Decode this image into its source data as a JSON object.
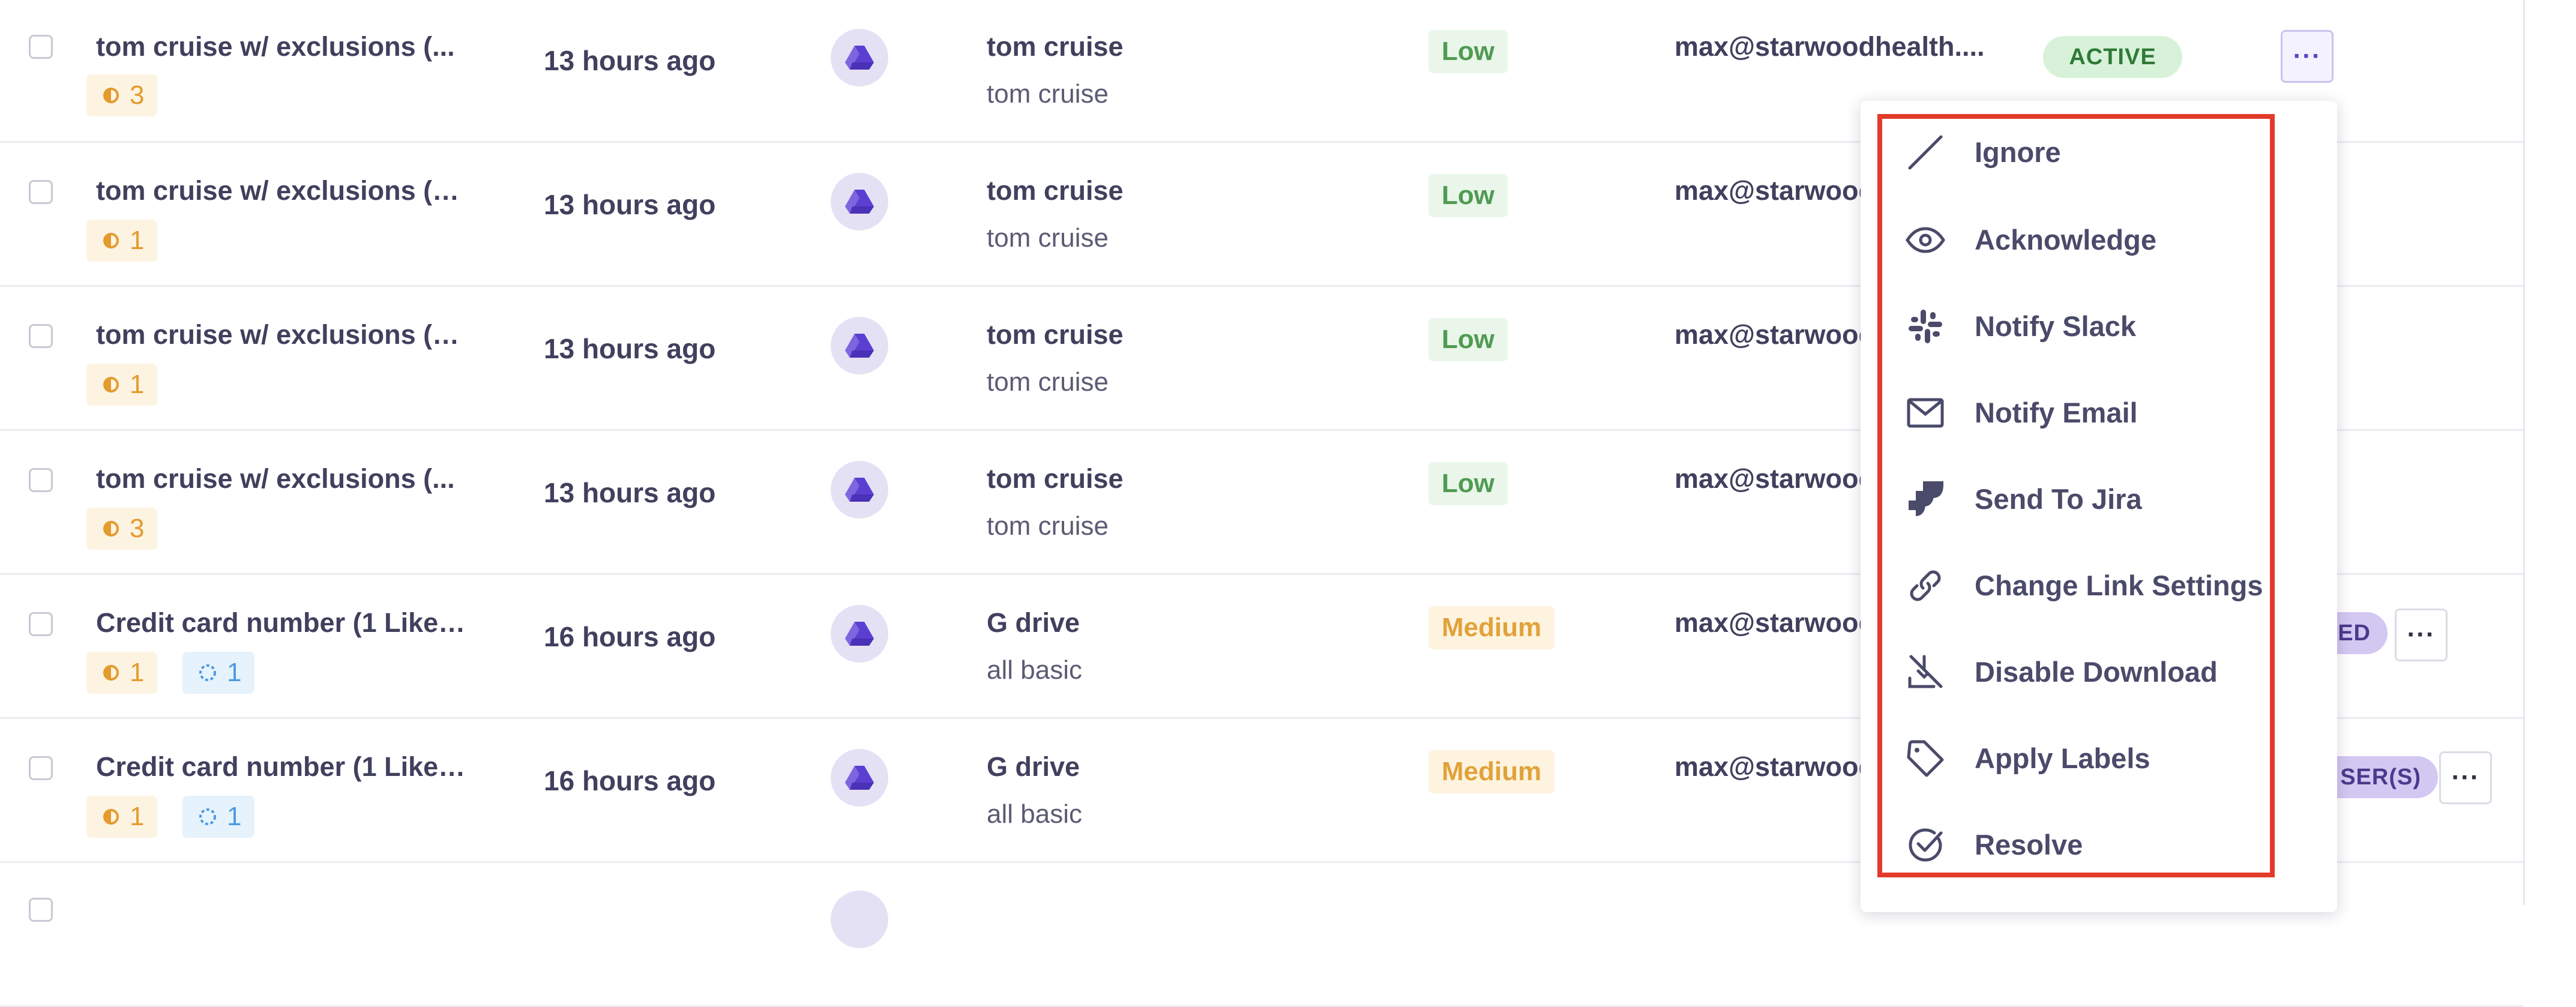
{
  "rows": [
    {
      "title": "tom cruise w/ exclusions (...",
      "chips": [
        {
          "kind": "orange",
          "icon": "half-circle-icon",
          "count": "3"
        }
      ],
      "time": "13 hours ago",
      "source_icon": "google-drive-icon",
      "owner": "tom cruise",
      "subowner": "tom cruise",
      "severity": "Low",
      "email": "max@starwoodhealth....",
      "status": "ACTIVE"
    },
    {
      "title": "tom cruise w/ exclusions (1...",
      "chips": [
        {
          "kind": "orange",
          "icon": "half-circle-icon",
          "count": "1"
        }
      ],
      "time": "13 hours ago",
      "source_icon": "google-drive-icon",
      "owner": "tom cruise",
      "subowner": "tom cruise",
      "severity": "Low",
      "email": "max@starwood"
    },
    {
      "title": "tom cruise w/ exclusions (1...",
      "chips": [
        {
          "kind": "orange",
          "icon": "half-circle-icon",
          "count": "1"
        }
      ],
      "time": "13 hours ago",
      "source_icon": "google-drive-icon",
      "owner": "tom cruise",
      "subowner": "tom cruise",
      "severity": "Low",
      "email": "max@starwood"
    },
    {
      "title": "tom cruise w/ exclusions (...",
      "chips": [
        {
          "kind": "orange",
          "icon": "half-circle-icon",
          "count": "3"
        }
      ],
      "time": "13 hours ago",
      "source_icon": "google-drive-icon",
      "owner": "tom cruise",
      "subowner": "tom cruise",
      "severity": "Low",
      "email": "max@starwood"
    },
    {
      "title": "Credit card number (1 Likel...",
      "chips": [
        {
          "kind": "orange",
          "icon": "half-circle-icon",
          "count": "1"
        },
        {
          "kind": "blue",
          "icon": "dashed-circle-icon",
          "count": "1"
        }
      ],
      "time": "16 hours ago",
      "source_icon": "google-drive-icon",
      "owner": "G drive",
      "subowner": "all basic",
      "severity": "Medium",
      "email": "max@starwood",
      "status": "ED"
    },
    {
      "title": "Credit card number (1 Likel...",
      "chips": [
        {
          "kind": "orange",
          "icon": "half-circle-icon",
          "count": "1"
        },
        {
          "kind": "blue",
          "icon": "dashed-circle-icon",
          "count": "1"
        }
      ],
      "time": "16 hours ago",
      "source_icon": "google-drive-icon",
      "owner": "G drive",
      "subowner": "all basic",
      "severity": "Medium",
      "email": "max@starwood",
      "status": "SER(S)"
    }
  ],
  "more_button_label": "···",
  "menu": {
    "items": [
      {
        "label": "Ignore",
        "icon": "slash-icon"
      },
      {
        "label": "Acknowledge",
        "icon": "eye-icon"
      },
      {
        "label": "Notify Slack",
        "icon": "slack-icon"
      },
      {
        "label": "Notify Email",
        "icon": "envelope-icon"
      },
      {
        "label": "Send To Jira",
        "icon": "jira-icon"
      },
      {
        "label": "Change Link Settings",
        "icon": "link-icon"
      },
      {
        "label": "Disable Download",
        "icon": "download-off-icon"
      },
      {
        "label": "Apply Labels",
        "icon": "tag-icon"
      },
      {
        "label": "Resolve",
        "icon": "check-circle-icon"
      }
    ]
  },
  "colors": {
    "accent": "#5a45c9",
    "highlight": "#e23b2a",
    "low": "#4f9b52",
    "medium": "#e2a23b",
    "active_bg": "#d8f2d9",
    "status_purple_bg": "#d3c8f2"
  }
}
